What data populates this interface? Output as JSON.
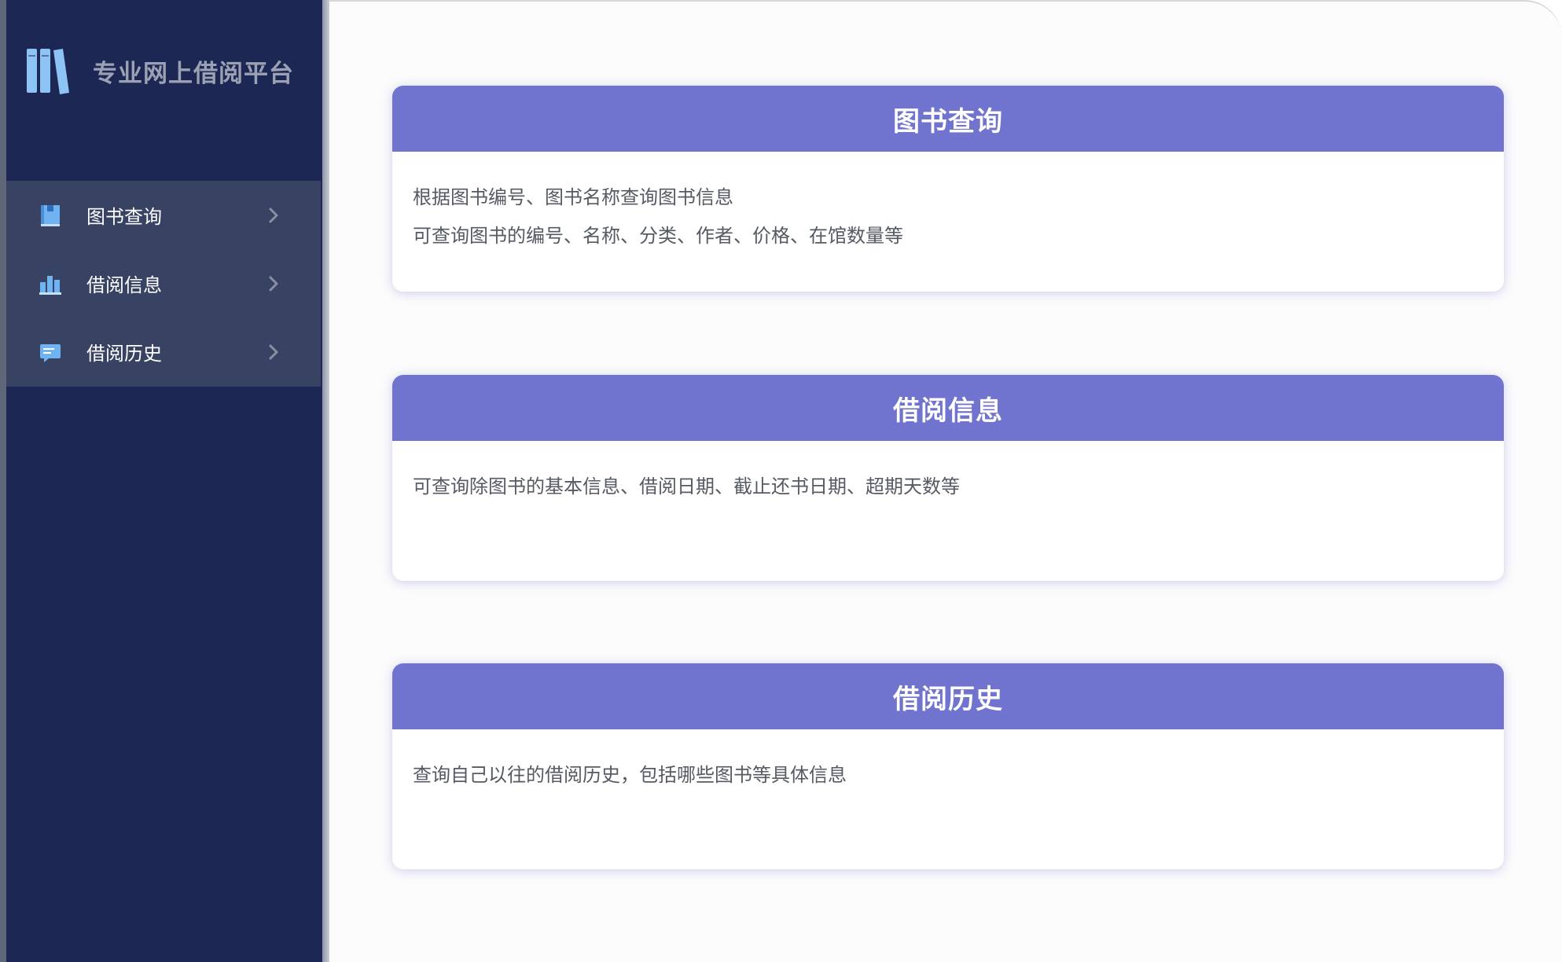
{
  "brand": {
    "title": "专业网上借阅平台",
    "icon": "books-icon"
  },
  "sidebar": {
    "items": [
      {
        "label": "图书查询",
        "icon": "book-icon"
      },
      {
        "label": "借阅信息",
        "icon": "bar-chart-icon"
      },
      {
        "label": "借阅历史",
        "icon": "message-icon"
      }
    ]
  },
  "cards": [
    {
      "title": "图书查询",
      "lines": [
        "根据图书编号、图书名称查询图书信息",
        "可查询图书的编号、名称、分类、作者、价格、在馆数量等"
      ]
    },
    {
      "title": "借阅信息",
      "lines": [
        "可查询除图书的基本信息、借阅日期、截止还书日期、超期天数等"
      ]
    },
    {
      "title": "借阅历史",
      "lines": [
        "查询自己以往的借阅历史，包括哪些图书等具体信息"
      ]
    }
  ],
  "colors": {
    "sidebar_bg": "#1c2754",
    "menu_bg": "#384262",
    "card_header": "#7074cf",
    "icon_blue": "#6fb3f2"
  }
}
